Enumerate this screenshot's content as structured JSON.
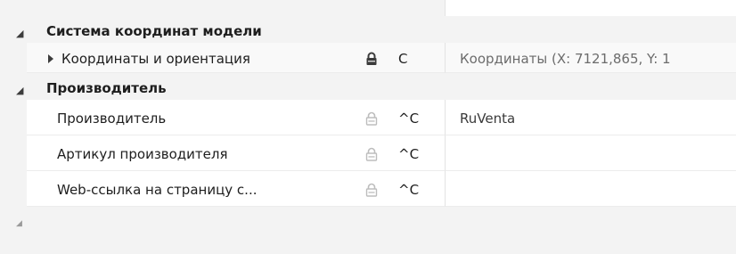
{
  "groups": [
    {
      "title": "Система координат модели",
      "expanded": true,
      "properties": [
        {
          "name": "Координаты и ориентация",
          "expandable": true,
          "lock": "locked-dark",
          "flag": "C",
          "value": "Координаты (X: 7121,865, Y: 1"
        }
      ]
    },
    {
      "title": "Производитель",
      "expanded": true,
      "properties": [
        {
          "name": "Производитель",
          "expandable": false,
          "lock": "locked-light",
          "flag": "^C",
          "value": "RuVenta"
        },
        {
          "name": "Артикул производителя",
          "expandable": false,
          "lock": "locked-light",
          "flag": "^C",
          "value": ""
        },
        {
          "name": "Web-ссылка на страницу с...",
          "expandable": false,
          "lock": "locked-light",
          "flag": "^C",
          "value": ""
        }
      ]
    }
  ],
  "colors": {
    "lock_dark": "#3b3b3b",
    "lock_light": "#bdbdbd",
    "category_bg": "#f3f3f3"
  }
}
